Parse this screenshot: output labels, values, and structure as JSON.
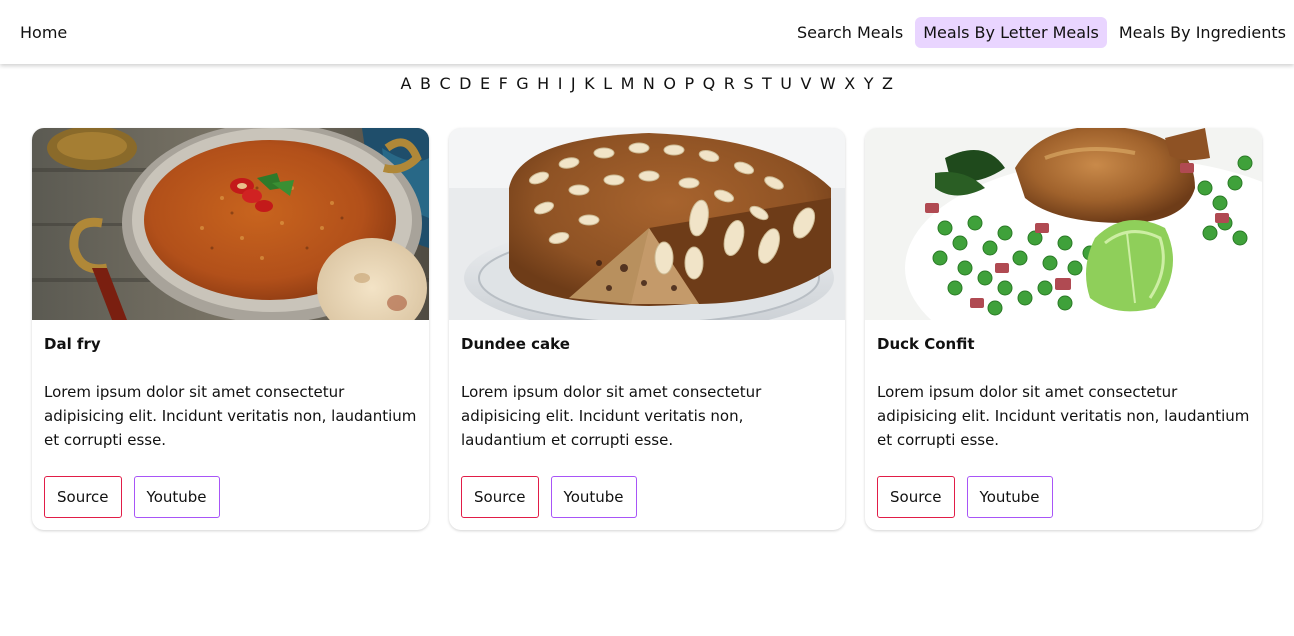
{
  "nav": {
    "home": "Home",
    "search_meals": "Search Meals",
    "meals_by_letter": "Meals By Letter Meals",
    "meals_by_ingredients": "Meals By Ingredients",
    "active_color": "#e9d5ff"
  },
  "letters": [
    "A",
    "B",
    "C",
    "D",
    "E",
    "F",
    "G",
    "H",
    "I",
    "J",
    "K",
    "L",
    "M",
    "N",
    "O",
    "P",
    "Q",
    "R",
    "S",
    "T",
    "U",
    "V",
    "W",
    "X",
    "Y",
    "Z"
  ],
  "meals": [
    {
      "name": "Dal fry",
      "description": "Lorem ipsum dolor sit amet consectetur adipisicing elit. Incidunt veritatis non, laudantium et corrupti esse.",
      "source_label": "Source",
      "youtube_label": "Youtube"
    },
    {
      "name": "Dundee cake",
      "description": "Lorem ipsum dolor sit amet consectetur adipisicing elit. Incidunt veritatis non, laudantium et corrupti esse.",
      "source_label": "Source",
      "youtube_label": "Youtube"
    },
    {
      "name": "Duck Confit",
      "description": "Lorem ipsum dolor sit amet consectetur adipisicing elit. Incidunt veritatis non, laudantium et corrupti esse.",
      "source_label": "Source",
      "youtube_label": "Youtube"
    }
  ],
  "colors": {
    "source_border": "#e11d48",
    "youtube_border": "#a855f7"
  }
}
